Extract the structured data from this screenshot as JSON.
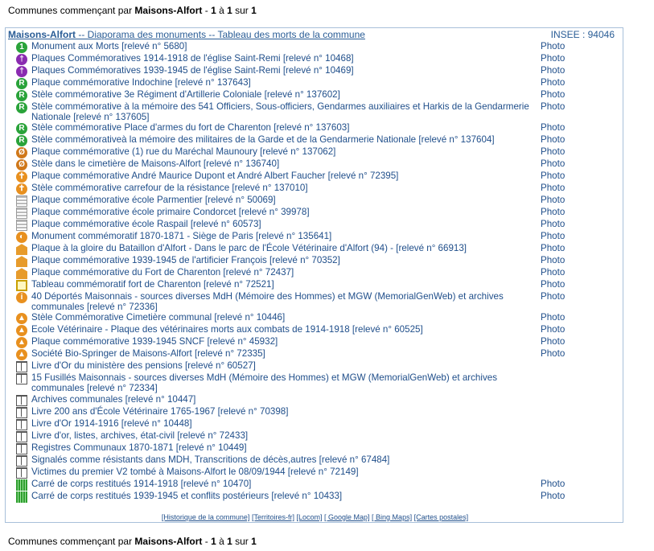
{
  "summary": {
    "prefix": "Communes commençant par ",
    "commune": "Maisons-Alfort",
    "sep": " - ",
    "from": "1",
    "a": " à ",
    "to": "1",
    "sur": " sur ",
    "total": "1"
  },
  "panel": {
    "commune": "Maisons-Alfort",
    "subtitle": " -- Diaporama des monuments -- Tableau des morts de la commune",
    "insee": "INSEE : 94046",
    "photo_label": "Photo"
  },
  "icon_colors": {
    "green": "#2aa33a",
    "purple": "#8a2bb0",
    "orange": "#e8901f",
    "dark_orange": "#d0781a"
  },
  "rows": [
    {
      "icon": "circle-green-1",
      "text": "Monument aux Morts [relevé n° 5680]",
      "photo": true
    },
    {
      "icon": "circle-purple",
      "text": "Plaques Commémoratives 1914-1918 de l'église Saint-Remi [relevé n° 10468]",
      "photo": true
    },
    {
      "icon": "circle-purple",
      "text": "Plaques Commémoratives 1939-1945 de l'église Saint-Remi [relevé n° 10469]",
      "photo": true
    },
    {
      "icon": "circle-green-r",
      "text": "Plaque commémorative Indochine [relevé n° 137643]",
      "photo": true
    },
    {
      "icon": "circle-green-r",
      "text": "Stèle commémorative 3e Régiment d'Artillerie Coloniale [relevé n° 137602]",
      "photo": true
    },
    {
      "icon": "circle-green-r",
      "text": "Stèle commémorative à la mémoire des 541 Officiers, Sous-officiers, Gendarmes auxiliaires et Harkis de la Gendarmerie Nationale [relevé n° 137605]",
      "photo": true
    },
    {
      "icon": "circle-green-r",
      "text": "Stèle commémorative Place d'armes du fort de Charenton [relevé n° 137603]",
      "photo": true
    },
    {
      "icon": "circle-green-r",
      "text": "Stèle commémorativeà la mémoire des militaires de la Garde et de la Gendarmerie Nationale [relevé n° 137604]",
      "photo": true
    },
    {
      "icon": "circle-orange-slash",
      "text": "Plaque commémorative (1) rue du Maréchal Maunoury [relevé n° 137062]",
      "photo": true
    },
    {
      "icon": "circle-orange-slash",
      "text": "Stèle dans le cimetière de Maisons-Alfort [relevé n° 136740]",
      "photo": true
    },
    {
      "icon": "circle-orange-cross",
      "text": "Plaque commémorative André Maurice Dupont et André Albert Faucher [relevé n° 72395]",
      "photo": true
    },
    {
      "icon": "circle-orange-cross",
      "text": "Stèle commémorative carrefour de la résistance [relevé n° 137010]",
      "photo": true
    },
    {
      "icon": "grave",
      "text": "Plaque commémorative école Parmentier [relevé n° 50069]",
      "photo": true
    },
    {
      "icon": "grave",
      "text": "Plaque commémorative école primaire Condorcet [relevé n° 39978]",
      "photo": true
    },
    {
      "icon": "grave",
      "text": "Plaque commémorative école Raspail [relevé n° 60573]",
      "photo": true
    },
    {
      "icon": "circle-orange-flame",
      "text": "Monument commémoratif 1870-1871 - Siège de Paris [relevé n° 135641]",
      "photo": true
    },
    {
      "icon": "hut",
      "text": "Plaque à la gloire du Bataillon d'Alfort - Dans le parc de l'École Vétérinaire d'Alfort (94) - [relevé n° 66913]",
      "photo": true
    },
    {
      "icon": "hut",
      "text": "Plaque commémorative 1939-1945 de l'artificier François [relevé n° 70352]",
      "photo": true
    },
    {
      "icon": "hut",
      "text": "Plaque commémorative du Fort de Charenton [relevé n° 72437]",
      "photo": true
    },
    {
      "icon": "plaque",
      "text": "Tableau commémoratif fort de Charenton [relevé n° 72521]",
      "photo": true
    },
    {
      "icon": "circle-orange-i",
      "text": "40 Déportés Maisonnais - sources diverses MdH (Mémoire des Hommes) et MGW (MemorialGenWeb) et archives communales [relevé n° 72336]",
      "photo": true
    },
    {
      "icon": "circle-orange-stele",
      "text": "Stèle Commémorative Cimetière communal [relevé n° 10446]",
      "photo": true
    },
    {
      "icon": "circle-orange-stele",
      "text": "Ecole Vétérinaire - Plaque des vétérinaires morts aux combats de 1914-1918 [relevé n° 60525]",
      "photo": true
    },
    {
      "icon": "circle-orange-stele",
      "text": "Plaque commémorative 1939-1945 SNCF [relevé n° 45932]",
      "photo": true
    },
    {
      "icon": "circle-orange-stele",
      "text": "Société Bio-Springer de Maisons-Alfort [relevé n° 72335]",
      "photo": true
    },
    {
      "icon": "book",
      "text": "Livre d'Or du ministère des pensions [relevé n° 60527]",
      "photo": false
    },
    {
      "icon": "book",
      "text": "15 Fusillés Maisonnais - sources diverses MdH (Mémoire des Hommes) et MGW (MemorialGenWeb) et archives communales [relevé n° 72334]",
      "photo": false
    },
    {
      "icon": "book",
      "text": "Archives communales [relevé n° 10447]",
      "photo": false
    },
    {
      "icon": "book",
      "text": "Livre 200 ans d'École Vétérinaire 1765-1967 [relevé n° 70398]",
      "photo": false
    },
    {
      "icon": "book",
      "text": "Livre d'Or 1914-1916 [relevé n° 10448]",
      "photo": false
    },
    {
      "icon": "book",
      "text": "Livre d'or, listes, archives, état-civil [relevé n° 72433]",
      "photo": false
    },
    {
      "icon": "book",
      "text": "Registres Communaux 1870-1871 [relevé n° 10449]",
      "photo": false
    },
    {
      "icon": "book",
      "text": "Signalés comme résistants dans MDH, Transcritions de décès,autres [relevé n° 67484]",
      "photo": false
    },
    {
      "icon": "book",
      "text": "Victimes du premier V2 tombé à Maisons-Alfort le 08/09/1944 [relevé n° 72149]",
      "photo": false
    },
    {
      "icon": "grid",
      "text": "Carré de corps restitués 1914-1918 [relevé n° 10470]",
      "photo": true
    },
    {
      "icon": "grid",
      "text": "Carré de corps restitués 1939-1945 et conflits postérieurs [relevé n° 10433]",
      "photo": true
    }
  ],
  "footer_links": [
    "[Historique de la commune]",
    "[Territoires-fr]",
    "[Locom]",
    "[ Google Map]",
    "[ Bing Maps]",
    "[Cartes postales]"
  ]
}
